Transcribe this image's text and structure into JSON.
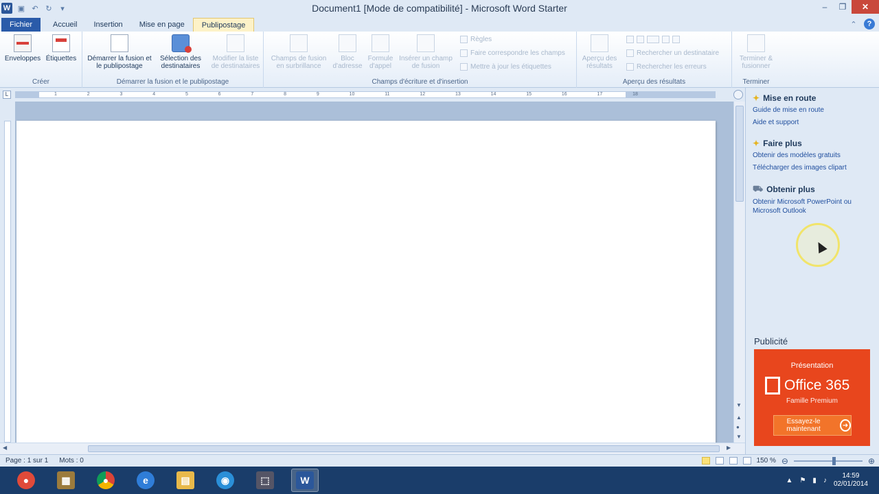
{
  "window": {
    "title": "Document1 [Mode de compatibilité] - Microsoft Word Starter",
    "app_icon": "W",
    "controls": {
      "minimize": "–",
      "maximize": "❐",
      "close": "✕"
    }
  },
  "quick_access": {
    "save_icon": "save-icon",
    "undo_icon": "undo-icon",
    "redo_icon": "redo-icon",
    "customize_icon": "customize-icon"
  },
  "tabs": [
    {
      "label": "Fichier"
    },
    {
      "label": "Accueil"
    },
    {
      "label": "Insertion"
    },
    {
      "label": "Mise en page"
    },
    {
      "label": "Publipostage"
    }
  ],
  "ribbon": {
    "groups": {
      "creer": {
        "label": "Créer",
        "buttons": [
          {
            "label": "Enveloppes"
          },
          {
            "label": "Étiquettes"
          }
        ]
      },
      "demarrer": {
        "label": "Démarrer la fusion et le publipostage",
        "buttons": [
          {
            "label": "Démarrer la fusion et le publipostage"
          },
          {
            "label": "Sélection des destinataires"
          },
          {
            "label": "Modifier la liste de destinataires"
          }
        ]
      },
      "champs": {
        "label": "Champs d'écriture et d'insertion",
        "buttons": [
          {
            "label": "Champs de fusion en surbrillance"
          },
          {
            "label": "Bloc d'adresse"
          },
          {
            "label": "Formule d'appel"
          },
          {
            "label": "Insérer un champ de fusion"
          }
        ],
        "small": [
          {
            "label": "Règles"
          },
          {
            "label": "Faire correspondre les champs"
          },
          {
            "label": "Mettre à jour les étiquettes"
          }
        ]
      },
      "apercu": {
        "label": "Aperçu des résultats",
        "buttons": [
          {
            "label": "Aperçu des résultats"
          }
        ],
        "small": [
          {
            "label": "Rechercher un destinataire"
          },
          {
            "label": "Rechercher les erreurs"
          }
        ]
      },
      "terminer": {
        "label": "Terminer",
        "buttons": [
          {
            "label": "Terminer & fusionner"
          }
        ]
      }
    }
  },
  "ruler": {
    "corner": "L",
    "numbers": [
      "1",
      "2",
      "3",
      "4",
      "5",
      "6",
      "7",
      "8",
      "9",
      "10",
      "11",
      "12",
      "13",
      "14",
      "15",
      "16",
      "17",
      "18"
    ]
  },
  "sidepane": {
    "sections": [
      {
        "title": "Mise en route",
        "links": [
          "Guide de mise en route",
          "Aide et support"
        ]
      },
      {
        "title": "Faire plus",
        "links": [
          "Obtenir des modèles gratuits",
          "Télécharger des images clipart"
        ]
      },
      {
        "title": "Obtenir plus",
        "links": [
          "Obtenir Microsoft PowerPoint ou Microsoft Outlook"
        ]
      }
    ],
    "ad": {
      "heading": "Publicité",
      "presentation": "Présentation",
      "product": "Office 365",
      "edition": "Famille Premium",
      "cta": "Essayez-le maintenant"
    }
  },
  "statusbar": {
    "page": "Page : 1 sur 1",
    "words": "Mots : 0",
    "zoom": "150 %"
  },
  "taskbar": {
    "items": [
      "chrome-start",
      "archive",
      "chrome",
      "internet-explorer",
      "file-explorer",
      "network",
      "snipping-tool",
      "word"
    ],
    "time": "14:59",
    "date": "02/01/2014"
  }
}
